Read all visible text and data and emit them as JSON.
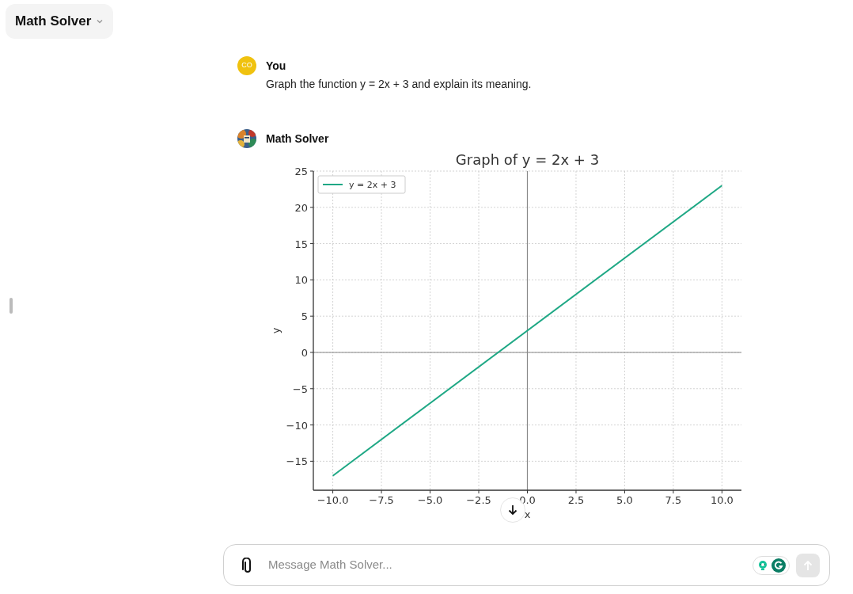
{
  "header": {
    "title": "Math Solver"
  },
  "messages": [
    {
      "kind": "text",
      "author": "You",
      "avatar": {
        "kind": "initials",
        "initials": "CO"
      },
      "text": "Graph the function y = 2x + 3 and explain its meaning."
    },
    {
      "kind": "chart",
      "author": "Math Solver",
      "chart_data": {
        "type": "line",
        "grid": true,
        "title": "Graph of y = 2x + 3",
        "xlabel": "x",
        "ylabel": "y",
        "x": [
          -10,
          10
        ],
        "series": [
          {
            "name": "y = 2x + 3",
            "color": "#1fa885",
            "values": [
              -17,
              23
            ]
          }
        ],
        "xlim": [
          -11,
          11
        ],
        "ylim": [
          -19,
          25
        ],
        "xticks": [
          {
            "value": -10,
            "label": "−10.0"
          },
          {
            "value": -7.5,
            "label": "−7.5"
          },
          {
            "value": -5,
            "label": "−5.0"
          },
          {
            "value": -2.5,
            "label": "−2.5"
          },
          {
            "value": 0,
            "label": "0.0"
          },
          {
            "value": 2.5,
            "label": "2.5"
          },
          {
            "value": 5,
            "label": "5.0"
          },
          {
            "value": 7.5,
            "label": "7.5"
          },
          {
            "value": 10,
            "label": "10.0"
          }
        ],
        "yticks": [
          {
            "value": -15,
            "label": "−15"
          },
          {
            "value": -10,
            "label": "−10"
          },
          {
            "value": -5,
            "label": "−5"
          },
          {
            "value": 0,
            "label": "0"
          },
          {
            "value": 5,
            "label": "5"
          },
          {
            "value": 10,
            "label": "10"
          },
          {
            "value": 15,
            "label": "15"
          },
          {
            "value": 20,
            "label": "20"
          },
          {
            "value": 25,
            "label": "25"
          }
        ]
      }
    }
  ],
  "composer": {
    "placeholder": "Message Math Solver...",
    "send_disabled": true
  }
}
